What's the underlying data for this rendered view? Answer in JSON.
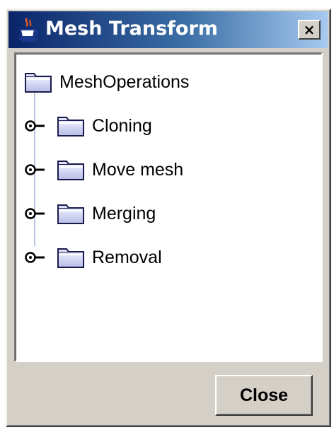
{
  "window": {
    "title": "Mesh Transform",
    "close_glyph": "×",
    "title_gradient": [
      "#0a246a",
      "#a6caf0"
    ],
    "icon": "java-cup-icon"
  },
  "tree": {
    "root": {
      "label": "MeshOperations",
      "icon": "folder-icon"
    },
    "children": [
      {
        "label": "Cloning",
        "icon": "folder-icon",
        "expand_icon": "collapsed-node-handle-icon"
      },
      {
        "label": "Move mesh",
        "icon": "folder-icon",
        "expand_icon": "collapsed-node-handle-icon"
      },
      {
        "label": "Merging",
        "icon": "folder-icon",
        "expand_icon": "collapsed-node-handle-icon"
      },
      {
        "label": "Removal",
        "icon": "folder-icon",
        "expand_icon": "collapsed-node-handle-icon"
      }
    ]
  },
  "buttons": {
    "close_label": "Close"
  }
}
